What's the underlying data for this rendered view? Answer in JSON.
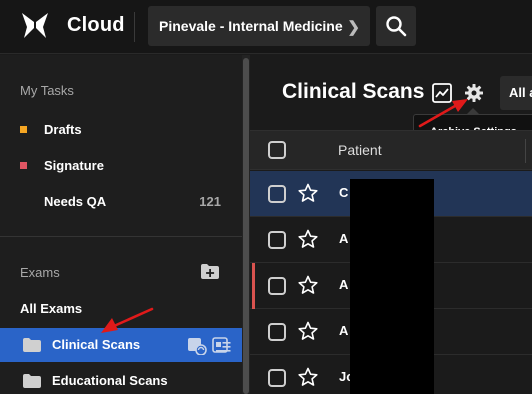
{
  "header": {
    "brand": "Cloud",
    "organization": "Pinevale - Internal Medicine"
  },
  "sidebar": {
    "tasks_title": "My Tasks",
    "tasks": [
      {
        "label": "Drafts",
        "color": "#f5a623",
        "count": ""
      },
      {
        "label": "Signature",
        "color": "#e05563",
        "count": ""
      },
      {
        "label": "Needs QA",
        "color": "",
        "count": "121"
      }
    ],
    "exams_title": "Exams",
    "all_exams": "All Exams",
    "folders": [
      {
        "label": "Clinical Scans",
        "active": true
      },
      {
        "label": "Educational Scans",
        "active": false
      }
    ]
  },
  "main": {
    "title": "Clinical Scans",
    "filter_label": "All a",
    "tooltip": "Archive Settings",
    "columns": {
      "patient": "Patient"
    },
    "rows": [
      {
        "patient": "C",
        "selected": true,
        "flagged": false
      },
      {
        "patient": "A",
        "selected": false,
        "flagged": false
      },
      {
        "patient": "A",
        "selected": false,
        "flagged": true
      },
      {
        "patient": "A",
        "selected": false,
        "flagged": false
      },
      {
        "patient": "Jo",
        "selected": false,
        "flagged": false
      }
    ]
  },
  "colors": {
    "accent": "#2a64c8",
    "selected_row": "#223556",
    "annotation_arrow": "#e01a1a"
  }
}
